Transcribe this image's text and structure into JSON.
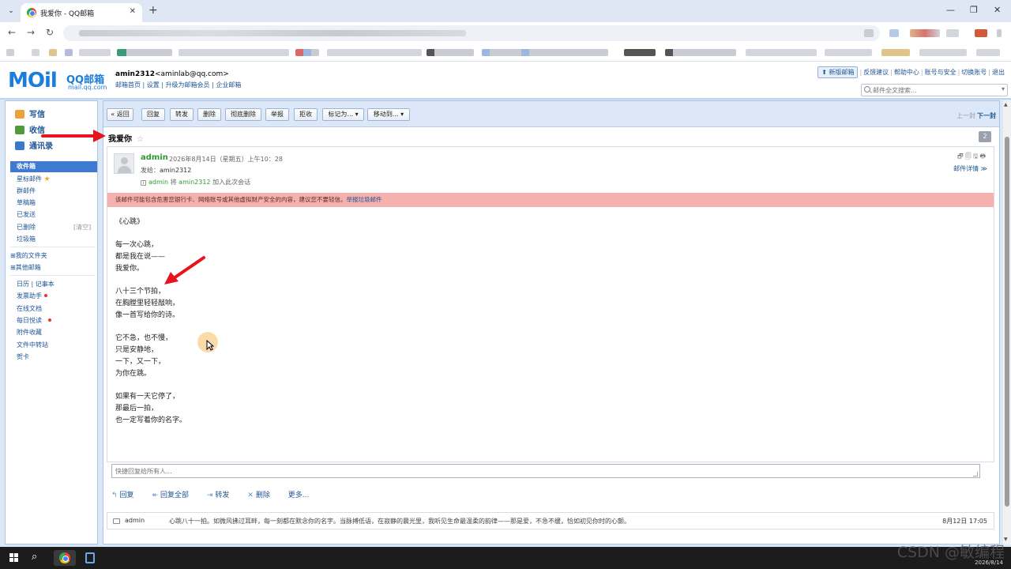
{
  "browser": {
    "tab_title": "我爱你 - QQ邮箱",
    "tab_close": "✕",
    "new_tab": "+",
    "minimize": "—",
    "restore": "❐",
    "close": "✕"
  },
  "header": {
    "logo_mail": "MOil",
    "logo_qq": "QQ邮箱",
    "logo_site": "mail.qq.com",
    "username": "amin2312",
    "email": "<aminlab@qq.com>",
    "links": [
      "邮箱首页",
      "设置",
      "升级为邮箱会员",
      "企业邮箱"
    ],
    "top_links": [
      "新版邮箱",
      "反馈建议",
      "帮助中心",
      "账号与安全",
      "切换账号",
      "退出"
    ],
    "search_placeholder": "邮件全文搜索..."
  },
  "sidebar": {
    "quick": [
      {
        "label": "写信",
        "icon": "pencil-icon",
        "color": "#e8a33a"
      },
      {
        "label": "收信",
        "icon": "inbox-icon",
        "color": "#4f9a3c"
      },
      {
        "label": "通讯录",
        "icon": "contacts-icon",
        "color": "#3a78c8"
      }
    ],
    "inbox": "收件箱",
    "folders": [
      "星标邮件",
      "群邮件",
      "草稿箱",
      "已发送",
      "已删除",
      "垃圾箱"
    ],
    "clear_label": "[清空]",
    "my_folders": "我的文件夹",
    "other_mail": "其他邮箱",
    "calendar": "日历",
    "notes": "记事本",
    "apps": [
      "发票助手",
      "在线文档",
      "每日悦读",
      "附件收藏",
      "文件中转站",
      "贺卡"
    ]
  },
  "toolbar": {
    "buttons": [
      "« 返回",
      "回复",
      "转发",
      "删除",
      "彻底删除",
      "举报",
      "拒收",
      "标记为... ▾",
      "移动到... ▾"
    ],
    "prev": "上一封",
    "next": "下一封"
  },
  "mail": {
    "subject": "我爱你",
    "star": "☆",
    "count": "2",
    "sender": "admin",
    "time": "2026年8月14日（星期五）上午10：28",
    "to_label": "发给：",
    "to": "amin2312",
    "tip_prefix": "i",
    "tip_sender": "admin",
    "tip_mid": "将",
    "tip_recipient": "amin2312",
    "tip_suffix": "加入此次会话",
    "card_icons": "🗗🗐🖫🖶",
    "detail": "邮件详情 ≫",
    "warning": "该邮件可能包含危害您银行卡、网络账号或其他虚拟财产安全的内容，建议您不要轻信。",
    "warning_link": "举报垃圾邮件",
    "poem": [
      "《心跳》",
      "",
      "每一次心跳，",
      "都是我在说——",
      "我爱你。",
      "",
      "八十三个节拍，",
      "在胸膛里轻轻敲响，",
      "像一首写给你的诗。",
      "",
      "它不急，也不慢，",
      "只是安静地，",
      "一下，又一下，",
      "为你在跳。",
      "",
      "如果有一天它停了，",
      "那最后一拍，",
      "也一定写着你的名字。"
    ],
    "reply_placeholder": "快捷回复给所有人..."
  },
  "actions": [
    {
      "icon": "↰",
      "label": "回复"
    },
    {
      "icon": "↞",
      "label": "回复全部"
    },
    {
      "icon": "⇥",
      "label": "转发"
    },
    {
      "icon": "✕",
      "label": "删除"
    },
    {
      "icon": "",
      "label": "更多..."
    }
  ],
  "conversation": {
    "from": "admin",
    "snippet": "心跳八十一拍。如微风拂过耳畔，每一刻都在默念你的名字。当脉搏低语，在寂静的晨光里，我听见生命最温柔的韵律——那是爱，不急不缓，恰如初见你时的心颤。",
    "time": "8月12日 17:05"
  },
  "taskbar": {
    "date": "2026/8/14"
  },
  "watermark": "CSDN @敏编程",
  "colors": {
    "accent": "#1b7ddc",
    "link": "#1e5494",
    "warning_bg": "#f5b1ad",
    "sender_green": "#2f9a2f",
    "annotation_red": "#e8141b"
  }
}
